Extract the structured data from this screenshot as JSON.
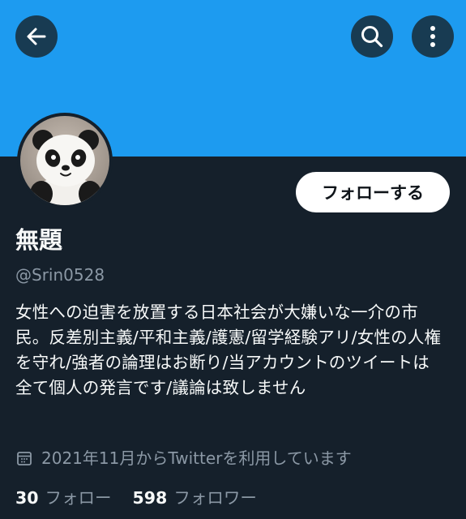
{
  "header": {
    "back_icon": "arrow-left-icon",
    "search_icon": "search-icon",
    "more_icon": "more-vertical-icon",
    "banner_color": "#1d9bf0",
    "button_bg": "#183b52"
  },
  "profile": {
    "avatar_icon": "panda-avatar",
    "follow_button_label": "フォローする",
    "display_name": "無題",
    "handle": "@Srin0528",
    "bio": "女性への迫害を放置する日本社会が大嫌いな一介の市民。反差別主義/平和主義/護憲/留学経験アリ/女性の人権を守れ/強者の論理はお断り/当アカウントのツイートは全て個人の発言です/議論は致しません",
    "joined_icon": "calendar-icon",
    "joined_text": "2021年11月からTwitterを利用しています",
    "following_count": "30",
    "following_label": "フォロー",
    "followers_count": "598",
    "followers_label": "フォロワー"
  },
  "colors": {
    "background": "#15202b",
    "primary_text": "#f7f9f9",
    "secondary_text": "#8b98a5"
  }
}
